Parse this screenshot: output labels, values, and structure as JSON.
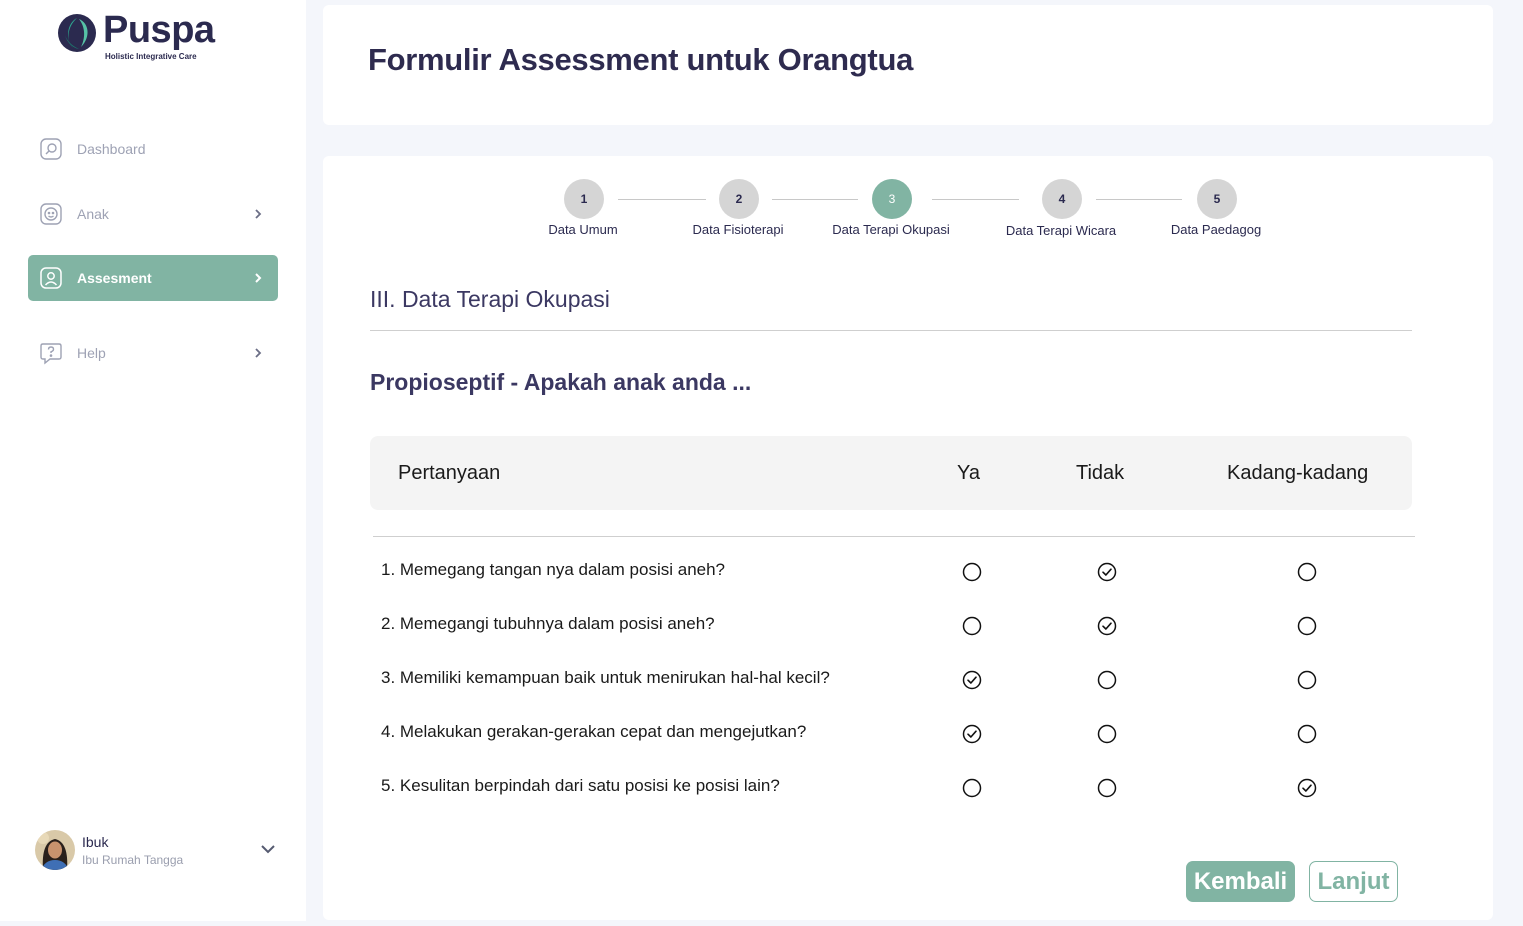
{
  "brand": {
    "name": "Puspa",
    "tagline": "Holistic Integrative Care",
    "accent_color": "#81b4a3",
    "text_color": "#2e2b4f"
  },
  "sidebar": {
    "items": [
      {
        "label": "Dashboard",
        "icon": "dashboard-icon",
        "has_chevron": false,
        "active": false
      },
      {
        "label": "Anak",
        "icon": "child-face-icon",
        "has_chevron": true,
        "active": false
      },
      {
        "label": "Assesment",
        "icon": "user-profile-icon",
        "has_chevron": true,
        "active": true
      },
      {
        "label": "Help",
        "icon": "help-question-icon",
        "has_chevron": true,
        "active": false
      }
    ]
  },
  "user": {
    "name": "Ibuk",
    "role": "Ibu Rumah Tangga"
  },
  "header": {
    "title": "Formulir Assessment untuk Orangtua"
  },
  "stepper": {
    "current": 3,
    "steps": [
      {
        "number": "1",
        "label": "Data Umum"
      },
      {
        "number": "2",
        "label": "Data Fisioterapi"
      },
      {
        "number": "3",
        "label": "Data Terapi Okupasi"
      },
      {
        "number": "4",
        "label": "Data Terapi Wicara"
      },
      {
        "number": "5",
        "label": "Data Paedagog"
      }
    ]
  },
  "section": {
    "title": "III. Data Terapi Okupasi",
    "subtitle": "Propioseptif - Apakah anak anda ..."
  },
  "table": {
    "headers": [
      "Pertanyaan",
      "Ya",
      "Tidak",
      "Kadang-kadang"
    ],
    "rows": [
      {
        "question": "1. Memegang tangan nya dalam posisi aneh?",
        "answer": "Tidak"
      },
      {
        "question": "2. Memegangi tubuhnya dalam posisi aneh?",
        "answer": "Tidak"
      },
      {
        "question": "3. Memiliki kemampuan baik untuk menirukan hal-hal kecil?",
        "answer": "Ya"
      },
      {
        "question": "4. Melakukan gerakan-gerakan cepat dan mengejutkan?",
        "answer": "Ya"
      },
      {
        "question": "5. Kesulitan berpindah dari satu posisi ke posisi lain?",
        "answer": "Kadang-kadang"
      }
    ]
  },
  "buttons": {
    "back_label": "Kembali",
    "next_label": "Lanjut"
  }
}
